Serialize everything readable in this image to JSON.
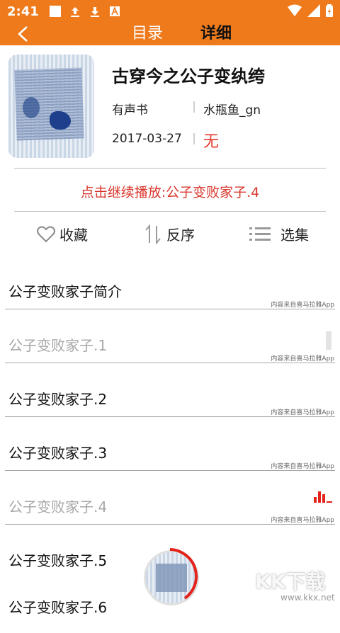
{
  "status_bar": {
    "time": "2:41"
  },
  "app_bar": {
    "tab_catalog": "目录",
    "tab_detail": "详细"
  },
  "book": {
    "title": "古穿今之公子变纨绔",
    "type": "有声书",
    "author": "水瓶鱼_gn",
    "date": "2017-03-27",
    "status": "无"
  },
  "continue_play": "点击继续播放:公子变败家子.4",
  "actions": {
    "favorite": "收藏",
    "reverse": "反序",
    "select": "选集"
  },
  "episodes": [
    {
      "title": "公子变败家子简介",
      "source": "内容来自喜马拉雅App",
      "state": "normal"
    },
    {
      "title": "公子变败家子.1",
      "source": "内容来自喜马拉雅App",
      "state": "played"
    },
    {
      "title": "公子变败家子.2",
      "source": "内容来自喜马拉雅App",
      "state": "normal"
    },
    {
      "title": "公子变败家子.3",
      "source": "内容来自喜马拉雅App",
      "state": "normal"
    },
    {
      "title": "公子变败家子.4",
      "source": "内容来自喜马拉雅App",
      "state": "playing"
    },
    {
      "title": "公子变败家子.5",
      "source": "",
      "state": "normal"
    },
    {
      "title": "公子变败家子.6",
      "source": "",
      "state": "normal"
    }
  ],
  "watermark": {
    "logo": "KK下载",
    "url": "www.kkx.net"
  },
  "colors": {
    "accent": "#ee7a1c",
    "red": "#d9362b"
  }
}
